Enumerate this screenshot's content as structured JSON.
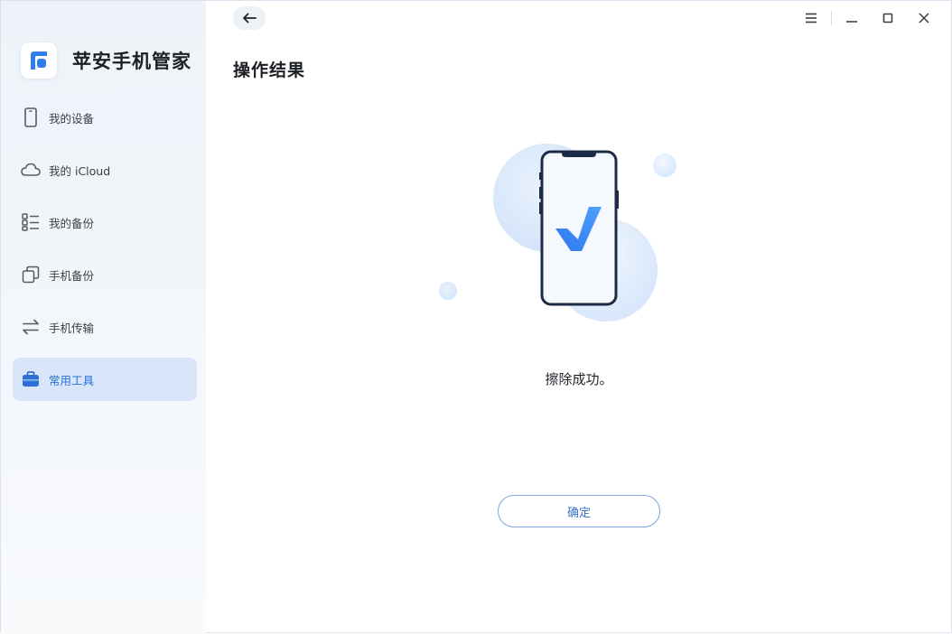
{
  "app": {
    "name": "苹安手机管家"
  },
  "sidebar": {
    "items": [
      {
        "label": "我的设备",
        "icon": "phone-icon"
      },
      {
        "label": "我的 iCloud",
        "icon": "cloud-icon"
      },
      {
        "label": "我的备份",
        "icon": "list-icon"
      },
      {
        "label": "手机备份",
        "icon": "copy-icon"
      },
      {
        "label": "手机传输",
        "icon": "transfer-icon"
      },
      {
        "label": "常用工具",
        "icon": "toolbox-icon",
        "active": true
      }
    ]
  },
  "main": {
    "title": "操作结果",
    "result_message": "擦除成功。",
    "confirm_label": "确定"
  },
  "colors": {
    "accent": "#2a6fdb",
    "active_bg": "#d9e6fa"
  }
}
